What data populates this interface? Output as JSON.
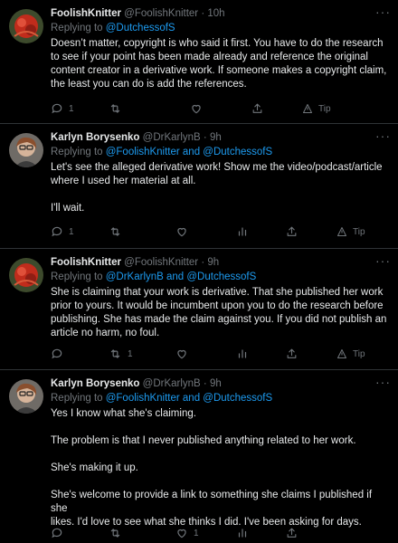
{
  "tweets": [
    {
      "name": "FoolishKnitter",
      "handle": "@FoolishKnitter",
      "time": "10h",
      "replying_prefix": "Replying to ",
      "mentions": "@DutchessofS",
      "lines": [
        "Doesn’t matter, copyright is who said it first.  You have to do the research",
        "to see if your point has been made already and reference the original",
        "content creator in a derivative work.  If someone makes a copyright claim,",
        "the least you can do is add the references."
      ],
      "reply_count": "1",
      "retweet_count": "",
      "tip_label": "Tip"
    },
    {
      "name": "Karlyn Borysenko",
      "handle": "@DrKarlynB",
      "time": "9h",
      "replying_prefix": "Replying to ",
      "mentions": "@FoolishKnitter and @DutchessofS",
      "lines": [
        "Let's see the alleged derivative work! Show me the video/podcast/article",
        "where I used her material at all.",
        "I'll wait."
      ],
      "reply_count": "1",
      "retweet_count": "",
      "tip_label": "Tip"
    },
    {
      "name": "FoolishKnitter",
      "handle": "@FoolishKnitter",
      "time": "9h",
      "replying_prefix": "Replying to ",
      "mentions": "@DrKarlynB and @DutchessofS",
      "lines": [
        "She is claiming that your work is derivative.  That she published her work",
        "prior to yours.  It would be incumbent upon you to do the research before",
        "publishing.  She has made the claim against you.  If you did not publish an",
        "article no harm, no foul."
      ],
      "reply_count": "",
      "retweet_count": "1",
      "tip_label": "Tip"
    },
    {
      "name": "Karlyn Borysenko",
      "handle": "@DrKarlynB",
      "time": "9h",
      "replying_prefix": "Replying to ",
      "mentions": "@FoolishKnitter and @DutchessofS",
      "lines": [
        "Yes I know what she's claiming.",
        "The problem is that I never published anything related to her work.",
        "She's making it up.",
        "She's welcome to provide a link to something she claims I published if she",
        "likes. I'd love to see what she thinks I did. I've been asking for days."
      ],
      "reply_count": "",
      "retweet_count": "",
      "like_count": "1"
    }
  ],
  "icons": {
    "reply": "reply-icon",
    "retweet": "retweet-icon",
    "like": "heart-icon",
    "analytics": "analytics-icon",
    "share": "share-icon",
    "tip": "tip-icon",
    "more": "more-icon"
  },
  "colors": {
    "background": "#000000",
    "text": "#e7e9ea",
    "muted": "#71767b",
    "link": "#1d9bf0",
    "divider": "#2f3336"
  }
}
